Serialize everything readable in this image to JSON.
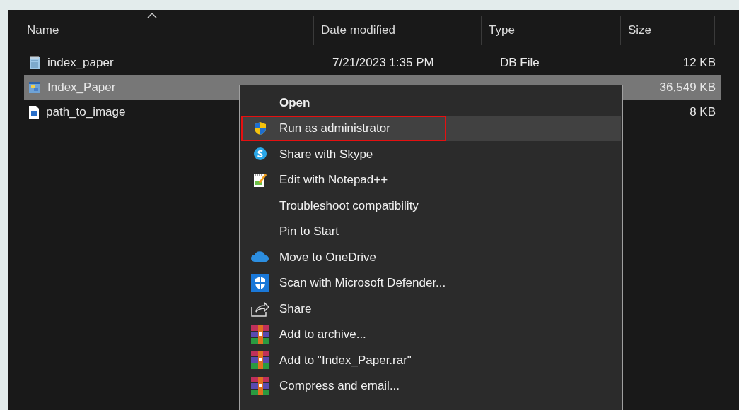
{
  "columns": [
    {
      "label": "Name",
      "sorted": true
    },
    {
      "label": "Date modified",
      "sorted": false
    },
    {
      "label": "Type",
      "sorted": false
    },
    {
      "label": "Size",
      "sorted": false
    }
  ],
  "files": [
    {
      "name": "index_paper",
      "date": "7/21/2023 1:35 PM",
      "type": "DB File",
      "size": "12 KB",
      "kind": "db",
      "selected": false
    },
    {
      "name": "Index_Paper",
      "size": "36,549 KB",
      "kind": "app",
      "selected": true
    },
    {
      "name": "path_to_image",
      "size": "8 KB",
      "kind": "image",
      "selected": false
    }
  ],
  "context_menu": {
    "items": [
      {
        "label": "Open",
        "kind": "plain",
        "default": true,
        "highlighted": false,
        "outlined": false
      },
      {
        "label": "Run as administrator",
        "kind": "admin",
        "default": false,
        "highlighted": true,
        "outlined": true
      },
      {
        "label": "Share with Skype",
        "kind": "skype",
        "default": false,
        "highlighted": false,
        "outlined": false
      },
      {
        "label": "Edit with Notepad++",
        "kind": "editor",
        "default": false,
        "highlighted": false,
        "outlined": false
      },
      {
        "label": "Troubleshoot compatibility",
        "kind": "plain",
        "default": false,
        "highlighted": false,
        "outlined": false
      },
      {
        "label": "Pin to Start",
        "kind": "plain",
        "default": false,
        "highlighted": false,
        "outlined": false
      },
      {
        "label": "Move to OneDrive",
        "kind": "cloud",
        "default": false,
        "highlighted": false,
        "outlined": false
      },
      {
        "label": "Scan with Microsoft Defender...",
        "kind": "scan",
        "default": false,
        "highlighted": false,
        "outlined": false
      },
      {
        "label": "Share",
        "kind": "share",
        "default": false,
        "highlighted": false,
        "outlined": false
      },
      {
        "label": "Add to archive...",
        "kind": "archive",
        "default": false,
        "highlighted": false,
        "outlined": false
      },
      {
        "label": "Add to \"Index_Paper.rar\"",
        "kind": "archive",
        "default": false,
        "highlighted": false,
        "outlined": false
      },
      {
        "label": "Compress and email...",
        "kind": "archive",
        "default": false,
        "highlighted": false,
        "outlined": false
      }
    ]
  }
}
